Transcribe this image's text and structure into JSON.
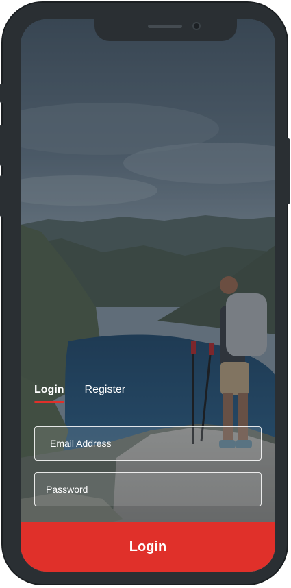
{
  "auth_tabs": {
    "login_label": "Login",
    "register_label": "Register",
    "active": "login"
  },
  "form": {
    "email": {
      "placeholder": "Email Address",
      "value": ""
    },
    "password": {
      "placeholder": "Password",
      "value": ""
    },
    "submit_label": "Login"
  },
  "colors": {
    "accent": "#e0302a",
    "frame": "#2a2f33"
  },
  "icons": {
    "camera": "front-camera-icon",
    "speaker": "earpiece-speaker-icon"
  }
}
